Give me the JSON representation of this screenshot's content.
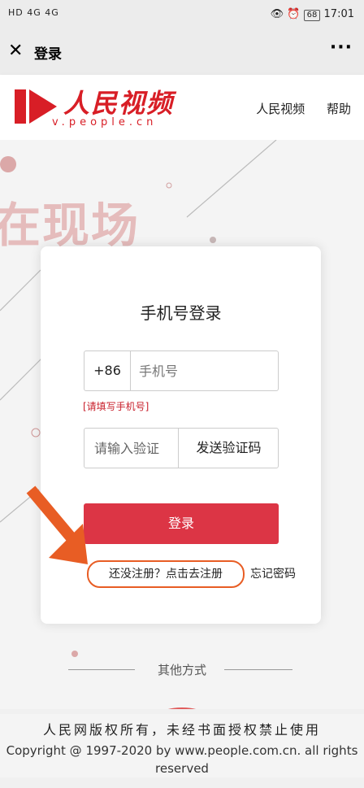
{
  "status_bar": {
    "network": "HD 4G 4G",
    "time": "17:01",
    "battery": "68"
  },
  "title_bar": {
    "title": "登录"
  },
  "site": {
    "logo_text": "人民视频",
    "logo_sub": "v.people.cn",
    "nav": [
      "人民视频",
      "帮助"
    ]
  },
  "background": {
    "text": "在现场"
  },
  "login": {
    "title": "手机号登录",
    "prefix": "+86",
    "phone_placeholder": "手机号",
    "phone_hint": "[请填写手机号]",
    "code_placeholder": "请输入验证",
    "send_code": "发送验证码",
    "login_button": "登录",
    "register_link": "还没注册？点击去注册",
    "forgot_link": "忘记密码"
  },
  "other_methods": "其他方式",
  "footer": {
    "cn": "人民网版权所有，未经书面授权禁止使用",
    "en": "Copyright @ 1997-2020 by www.people.com.cn. all rights reserved"
  }
}
